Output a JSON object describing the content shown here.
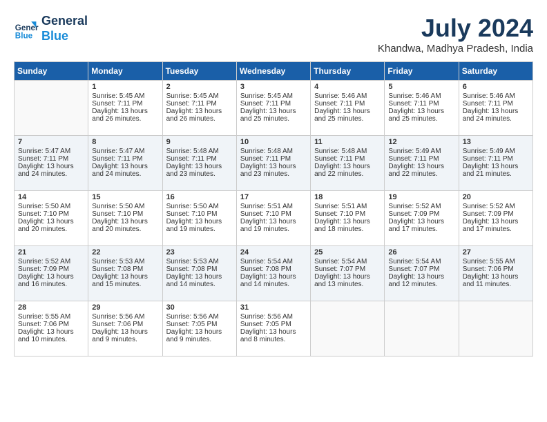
{
  "logo": {
    "line1": "General",
    "line2": "Blue"
  },
  "title": "July 2024",
  "location": "Khandwa, Madhya Pradesh, India",
  "weekdays": [
    "Sunday",
    "Monday",
    "Tuesday",
    "Wednesday",
    "Thursday",
    "Friday",
    "Saturday"
  ],
  "weeks": [
    [
      {
        "day": "",
        "sunrise": "",
        "sunset": "",
        "daylight": ""
      },
      {
        "day": "1",
        "sunrise": "Sunrise: 5:45 AM",
        "sunset": "Sunset: 7:11 PM",
        "daylight": "Daylight: 13 hours and 26 minutes."
      },
      {
        "day": "2",
        "sunrise": "Sunrise: 5:45 AM",
        "sunset": "Sunset: 7:11 PM",
        "daylight": "Daylight: 13 hours and 26 minutes."
      },
      {
        "day": "3",
        "sunrise": "Sunrise: 5:45 AM",
        "sunset": "Sunset: 7:11 PM",
        "daylight": "Daylight: 13 hours and 25 minutes."
      },
      {
        "day": "4",
        "sunrise": "Sunrise: 5:46 AM",
        "sunset": "Sunset: 7:11 PM",
        "daylight": "Daylight: 13 hours and 25 minutes."
      },
      {
        "day": "5",
        "sunrise": "Sunrise: 5:46 AM",
        "sunset": "Sunset: 7:11 PM",
        "daylight": "Daylight: 13 hours and 25 minutes."
      },
      {
        "day": "6",
        "sunrise": "Sunrise: 5:46 AM",
        "sunset": "Sunset: 7:11 PM",
        "daylight": "Daylight: 13 hours and 24 minutes."
      }
    ],
    [
      {
        "day": "7",
        "sunrise": "Sunrise: 5:47 AM",
        "sunset": "Sunset: 7:11 PM",
        "daylight": "Daylight: 13 hours and 24 minutes."
      },
      {
        "day": "8",
        "sunrise": "Sunrise: 5:47 AM",
        "sunset": "Sunset: 7:11 PM",
        "daylight": "Daylight: 13 hours and 24 minutes."
      },
      {
        "day": "9",
        "sunrise": "Sunrise: 5:48 AM",
        "sunset": "Sunset: 7:11 PM",
        "daylight": "Daylight: 13 hours and 23 minutes."
      },
      {
        "day": "10",
        "sunrise": "Sunrise: 5:48 AM",
        "sunset": "Sunset: 7:11 PM",
        "daylight": "Daylight: 13 hours and 23 minutes."
      },
      {
        "day": "11",
        "sunrise": "Sunrise: 5:48 AM",
        "sunset": "Sunset: 7:11 PM",
        "daylight": "Daylight: 13 hours and 22 minutes."
      },
      {
        "day": "12",
        "sunrise": "Sunrise: 5:49 AM",
        "sunset": "Sunset: 7:11 PM",
        "daylight": "Daylight: 13 hours and 22 minutes."
      },
      {
        "day": "13",
        "sunrise": "Sunrise: 5:49 AM",
        "sunset": "Sunset: 7:11 PM",
        "daylight": "Daylight: 13 hours and 21 minutes."
      }
    ],
    [
      {
        "day": "14",
        "sunrise": "Sunrise: 5:50 AM",
        "sunset": "Sunset: 7:10 PM",
        "daylight": "Daylight: 13 hours and 20 minutes."
      },
      {
        "day": "15",
        "sunrise": "Sunrise: 5:50 AM",
        "sunset": "Sunset: 7:10 PM",
        "daylight": "Daylight: 13 hours and 20 minutes."
      },
      {
        "day": "16",
        "sunrise": "Sunrise: 5:50 AM",
        "sunset": "Sunset: 7:10 PM",
        "daylight": "Daylight: 13 hours and 19 minutes."
      },
      {
        "day": "17",
        "sunrise": "Sunrise: 5:51 AM",
        "sunset": "Sunset: 7:10 PM",
        "daylight": "Daylight: 13 hours and 19 minutes."
      },
      {
        "day": "18",
        "sunrise": "Sunrise: 5:51 AM",
        "sunset": "Sunset: 7:10 PM",
        "daylight": "Daylight: 13 hours and 18 minutes."
      },
      {
        "day": "19",
        "sunrise": "Sunrise: 5:52 AM",
        "sunset": "Sunset: 7:09 PM",
        "daylight": "Daylight: 13 hours and 17 minutes."
      },
      {
        "day": "20",
        "sunrise": "Sunrise: 5:52 AM",
        "sunset": "Sunset: 7:09 PM",
        "daylight": "Daylight: 13 hours and 17 minutes."
      }
    ],
    [
      {
        "day": "21",
        "sunrise": "Sunrise: 5:52 AM",
        "sunset": "Sunset: 7:09 PM",
        "daylight": "Daylight: 13 hours and 16 minutes."
      },
      {
        "day": "22",
        "sunrise": "Sunrise: 5:53 AM",
        "sunset": "Sunset: 7:08 PM",
        "daylight": "Daylight: 13 hours and 15 minutes."
      },
      {
        "day": "23",
        "sunrise": "Sunrise: 5:53 AM",
        "sunset": "Sunset: 7:08 PM",
        "daylight": "Daylight: 13 hours and 14 minutes."
      },
      {
        "day": "24",
        "sunrise": "Sunrise: 5:54 AM",
        "sunset": "Sunset: 7:08 PM",
        "daylight": "Daylight: 13 hours and 14 minutes."
      },
      {
        "day": "25",
        "sunrise": "Sunrise: 5:54 AM",
        "sunset": "Sunset: 7:07 PM",
        "daylight": "Daylight: 13 hours and 13 minutes."
      },
      {
        "day": "26",
        "sunrise": "Sunrise: 5:54 AM",
        "sunset": "Sunset: 7:07 PM",
        "daylight": "Daylight: 13 hours and 12 minutes."
      },
      {
        "day": "27",
        "sunrise": "Sunrise: 5:55 AM",
        "sunset": "Sunset: 7:06 PM",
        "daylight": "Daylight: 13 hours and 11 minutes."
      }
    ],
    [
      {
        "day": "28",
        "sunrise": "Sunrise: 5:55 AM",
        "sunset": "Sunset: 7:06 PM",
        "daylight": "Daylight: 13 hours and 10 minutes."
      },
      {
        "day": "29",
        "sunrise": "Sunrise: 5:56 AM",
        "sunset": "Sunset: 7:06 PM",
        "daylight": "Daylight: 13 hours and 9 minutes."
      },
      {
        "day": "30",
        "sunrise": "Sunrise: 5:56 AM",
        "sunset": "Sunset: 7:05 PM",
        "daylight": "Daylight: 13 hours and 9 minutes."
      },
      {
        "day": "31",
        "sunrise": "Sunrise: 5:56 AM",
        "sunset": "Sunset: 7:05 PM",
        "daylight": "Daylight: 13 hours and 8 minutes."
      },
      {
        "day": "",
        "sunrise": "",
        "sunset": "",
        "daylight": ""
      },
      {
        "day": "",
        "sunrise": "",
        "sunset": "",
        "daylight": ""
      },
      {
        "day": "",
        "sunrise": "",
        "sunset": "",
        "daylight": ""
      }
    ]
  ]
}
